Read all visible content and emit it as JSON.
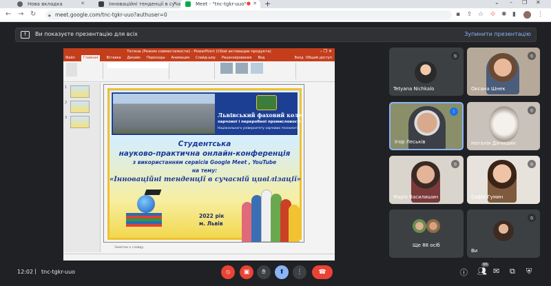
{
  "browser": {
    "tabs": [
      {
        "label": "Нова вкладка",
        "icon": "chrome-icon"
      },
      {
        "label": "Інноваційні тенденції в сучасн...",
        "icon": "doc-icon"
      },
      {
        "label": "Meet - \"tnc-tgkr-uuo\"",
        "icon": "meet-icon"
      }
    ],
    "url": "meet.google.com/tnc-tgkr-uuo?authuser=0"
  },
  "presentation_bar": {
    "message": "Ви показуєте презентацію для всіх",
    "stop_label": "Зупинити презентацію"
  },
  "ppt": {
    "title": "Тетяна (Режим совместимости) - PowerPoint (Сбой активации продукта)",
    "menu": [
      "Файл",
      "Главная",
      "Вставка",
      "Дизайн",
      "Переходы",
      "Анимация",
      "Слайд-шоу",
      "Рецензирование",
      "Вид"
    ],
    "menu_right": [
      "Вход",
      "Общий доступ"
    ],
    "notes": "Заметки к слайду",
    "slide": {
      "college_line1": "Львівський фаховий коледж",
      "college_line2": "харчової і переробної промисловості",
      "college_line3": "Національного університету харчових технологій",
      "heading1": "Студентська",
      "heading2": "науково-практична онлайн-конференція",
      "heading3": "з використанням сервісів Google Meet , YouTube",
      "heading4": "на тему:",
      "topic": "«Інноваційні тенденції в сучасній цивілізації»",
      "year": "2022 рік",
      "city": "м. Львів"
    }
  },
  "participants": [
    {
      "name": "Tetyana Nichkalo"
    },
    {
      "name": "Оксана Шнек"
    },
    {
      "name": "Ігор Леськів"
    },
    {
      "name": "Наталія Дячишин"
    },
    {
      "name": "Марія Василишин"
    },
    {
      "name": "Софія Гумин"
    },
    {
      "name": "Ще 88 осіб"
    },
    {
      "name": "Ви"
    }
  ],
  "bottom_bar": {
    "time": "12:02",
    "meeting_code": "tnc-tgkr-uuo",
    "participant_count": "96"
  }
}
